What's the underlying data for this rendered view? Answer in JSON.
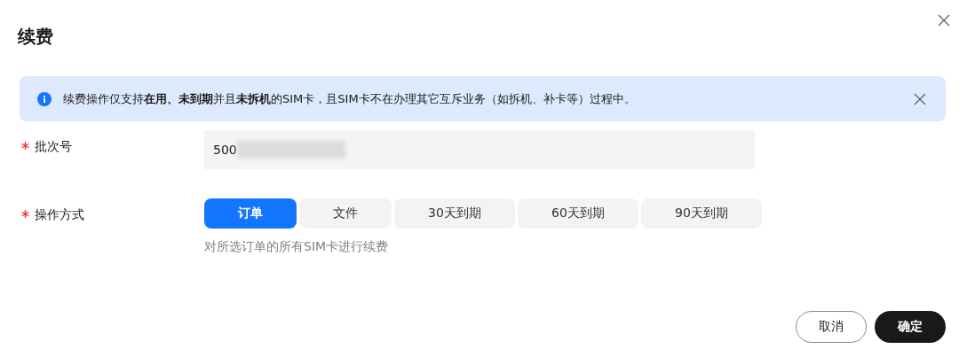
{
  "dialog": {
    "title": "续费"
  },
  "alert": {
    "text": "续费操作仅支持**在用、未到期**并且**未拆机**的SIM卡，且SIM卡不在办理其它互斥业务（如拆机、补卡等）过程中。"
  },
  "form": {
    "fields": [
      {
        "kind": "input",
        "label": "批次号",
        "required": true,
        "value": "500",
        "redacted": true
      },
      {
        "kind": "segmented",
        "label": "操作方式",
        "required": true,
        "options": [
          {
            "label": "订单",
            "selected": true
          },
          {
            "label": "文件",
            "selected": false
          },
          {
            "label": "30天到期",
            "selected": false
          },
          {
            "label": "60天到期",
            "selected": false
          },
          {
            "label": "90天到期",
            "selected": false
          }
        ],
        "hint": "对所选订单的所有SIM卡进行续费"
      }
    ]
  },
  "buttons": [
    {
      "kind": "secondary",
      "label": "取消"
    },
    {
      "kind": "primary",
      "label": "确定"
    }
  ]
}
